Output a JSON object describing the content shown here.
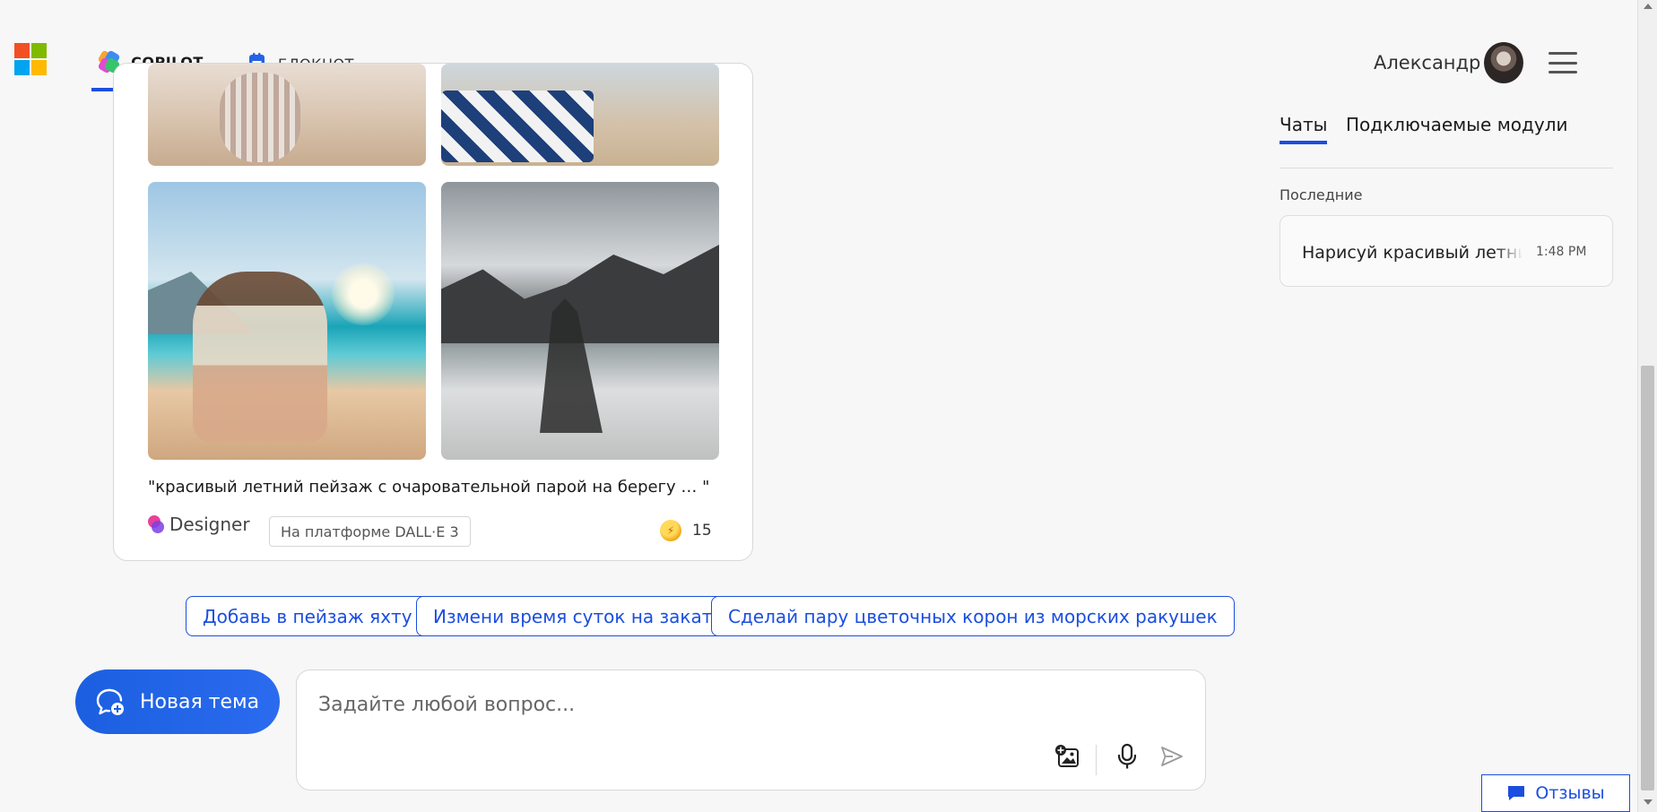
{
  "header": {
    "tabs": [
      {
        "label": "COPILOT",
        "active": true
      },
      {
        "label": "БЛОКНОТ",
        "active": false
      }
    ],
    "user_name": "Александр"
  },
  "colors": {
    "accent": "#1b4ee0",
    "ms_red": "#f25022",
    "ms_green": "#7fba00",
    "ms_blue": "#00a4ef",
    "ms_yellow": "#ffb900"
  },
  "card": {
    "caption": "\"красивый летний пейзаж с очаровательной парой на берегу … \"",
    "designer_label": "Designer",
    "platform_label": "На платформе DALL·E 3",
    "boosts": "15"
  },
  "suggestions": [
    "Добавь в пейзаж яхту",
    "Измени время суток на закат",
    "Сделай пару цветочных корон из морских ракушек"
  ],
  "composer": {
    "new_topic_label": "Новая тема",
    "placeholder": "Задайте любой вопрос..."
  },
  "right_panel": {
    "tabs": [
      "Чаты",
      "Подключаемые модули"
    ],
    "section_title": "Последние",
    "recent_chats": [
      {
        "title": "Нарисуй красивый летний пейзаж",
        "time": "1:48 PM"
      }
    ]
  },
  "feedback_label": "Отзывы"
}
